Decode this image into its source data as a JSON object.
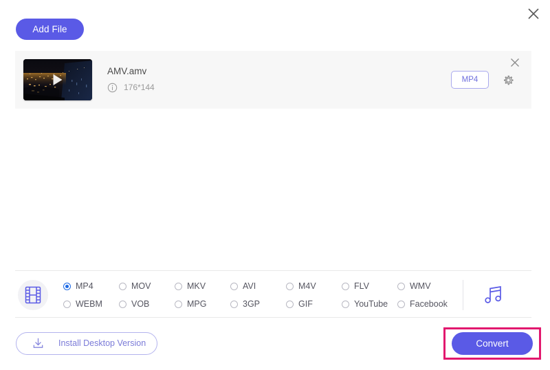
{
  "window": {
    "close_label": "×"
  },
  "toolbar": {
    "add_file_label": "Add File"
  },
  "file": {
    "name": "AMV.amv",
    "dimensions": "176*144",
    "output_format_chip": "MP4",
    "info_icon": "info-circle-icon",
    "gear_icon": "gear-icon",
    "remove_icon": "close-icon",
    "thumbnail_alt": "night-city-video-thumbnail",
    "play_icon": "play-triangle-icon"
  },
  "formats": {
    "video_icon": "film-strip-icon",
    "audio_icon": "music-note-icon",
    "selected": "MP4",
    "options": [
      {
        "label": "MP4",
        "selected": true
      },
      {
        "label": "MOV",
        "selected": false
      },
      {
        "label": "MKV",
        "selected": false
      },
      {
        "label": "AVI",
        "selected": false
      },
      {
        "label": "M4V",
        "selected": false
      },
      {
        "label": "FLV",
        "selected": false
      },
      {
        "label": "WMV",
        "selected": false
      },
      {
        "label": "WEBM",
        "selected": false
      },
      {
        "label": "VOB",
        "selected": false
      },
      {
        "label": "MPG",
        "selected": false
      },
      {
        "label": "3GP",
        "selected": false
      },
      {
        "label": "GIF",
        "selected": false
      },
      {
        "label": "YouTube",
        "selected": false
      },
      {
        "label": "Facebook",
        "selected": false
      }
    ]
  },
  "footer": {
    "install_label": "Install Desktop Version",
    "install_icon": "download-icon",
    "convert_label": "Convert"
  },
  "colors": {
    "accent": "#5a5ae6",
    "accent_soft": "#7b7bd8",
    "highlight": "#e2186e",
    "radio_selected": "#1d6ae5",
    "row_bg": "#f7f7f7"
  }
}
